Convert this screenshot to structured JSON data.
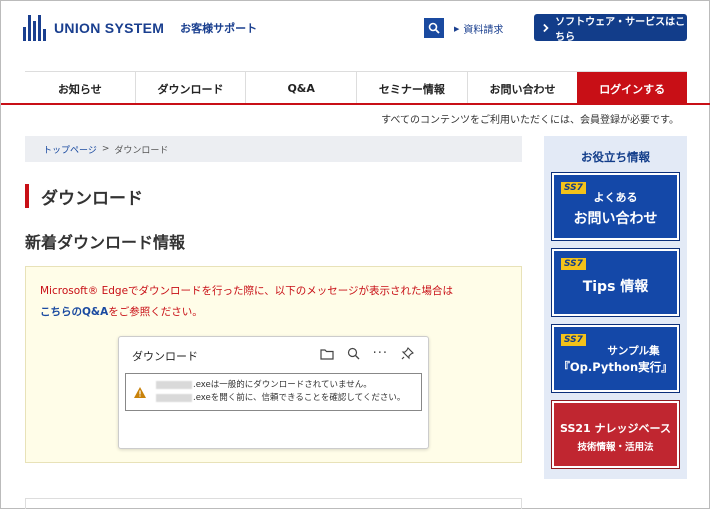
{
  "header": {
    "logo_name": "UNION SYSTEM",
    "logo_sub": "お客様サポート",
    "doc_link": "資料請求",
    "software_button": "ソフトウェア・サービスはこちら"
  },
  "nav": {
    "items": [
      "お知らせ",
      "ダウンロード",
      "Q&A",
      "セミナー情報",
      "お問い合わせ"
    ],
    "login": "ログインする"
  },
  "notice": "すべてのコンテンツをご利用いただくには、会員登録が必要です。",
  "breadcrumb": {
    "home": "トップページ",
    "sep": ">",
    "current": "ダウンロード"
  },
  "page_title": "ダウンロード",
  "section_title": "新着ダウンロード情報",
  "info": {
    "line1": "Microsoft® Edgeでダウンロードを行った際に、以下のメッセージが表示された場合は",
    "link": "こちらのQ&A",
    "line2_rest": "をご参照ください。",
    "panel_title": "ダウンロード",
    "warn1": ".exeは一般的にダウンロードされていません。",
    "warn2": ".exeを開く前に、信頼できることを確認してください。"
  },
  "sidebar": {
    "title": "お役立ち情報",
    "badge": "SS7",
    "card1_l1": "よくある",
    "card1_l2": "お問い合わせ",
    "card2": "Tips 情報",
    "card3_l1": "サンプル集",
    "card3_l2": "『Op.Python実行』",
    "card4_l1": "SS21 ナレッジベース",
    "card4_l2": "技術情報・活用法"
  },
  "colors": {
    "brand_blue": "#1a3f8f",
    "accent_red": "#c80f16"
  }
}
